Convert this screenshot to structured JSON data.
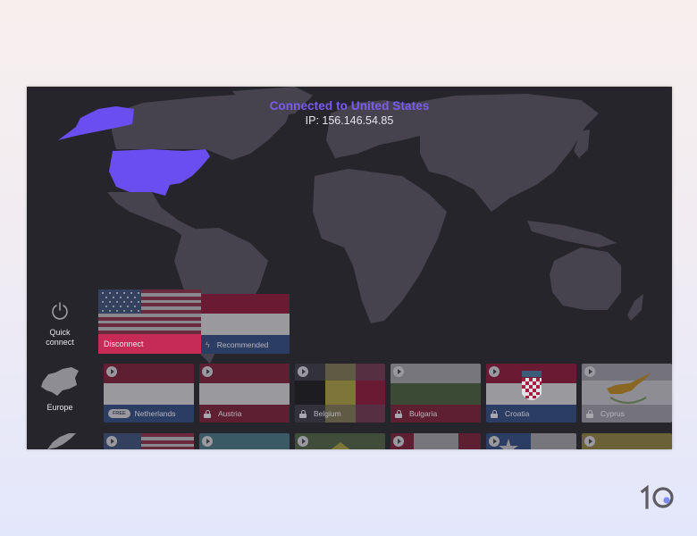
{
  "status": {
    "title": "Connected to United States",
    "ip": "IP: 156.146.54.85",
    "accent_color": "#7b5cf0"
  },
  "rail": {
    "quick_connect": {
      "icon": "power-icon",
      "label_line1": "Quick",
      "label_line2": "connect"
    },
    "europe": {
      "icon": "europe-map-icon",
      "label": "Europe"
    },
    "north_america": {
      "icon": "north-america-map-icon"
    }
  },
  "featured": {
    "current_flag": "united-states-flag",
    "disconnect_label": "Disconnect",
    "disconnect_color": "#c62b55",
    "recommended_label": "Recommended",
    "recommended_icon": "bolt-icon"
  },
  "europe_row": [
    {
      "name": "Netherlands",
      "badge": "FREE",
      "locked": false
    },
    {
      "name": "Austria",
      "locked": true
    },
    {
      "name": "Belgium",
      "locked": true
    },
    {
      "name": "Bulgaria",
      "locked": true
    },
    {
      "name": "Croatia",
      "locked": true
    },
    {
      "name": "Cyprus",
      "locked": true
    }
  ],
  "americas_row": [
    {
      "flag": "united-states-flag"
    },
    {
      "flag": "teal-flag"
    },
    {
      "flag": "brazil-flag"
    },
    {
      "flag": "canada-flag"
    },
    {
      "flag": "chile-flag"
    },
    {
      "flag": "gold-flag"
    }
  ],
  "brand": {
    "logo_text": "10",
    "dot_color": "#7e8af5"
  }
}
